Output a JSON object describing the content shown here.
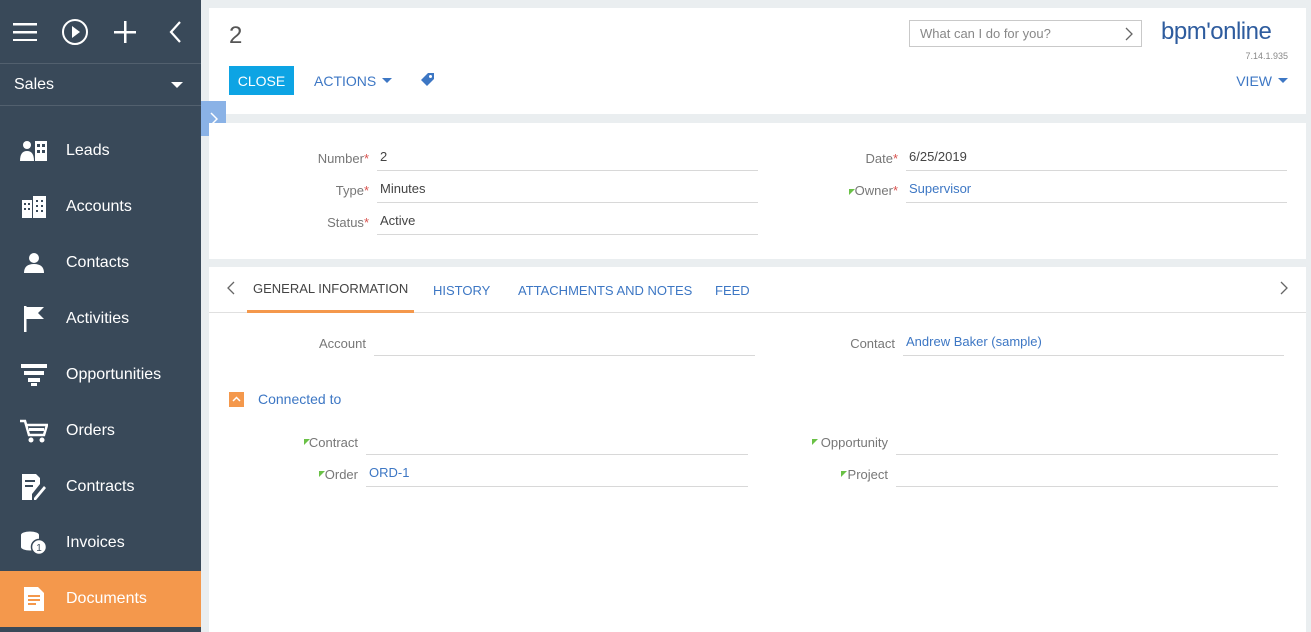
{
  "sidebar": {
    "workspace": "Sales",
    "items": [
      {
        "label": "Leads",
        "icon": "leads-icon"
      },
      {
        "label": "Accounts",
        "icon": "accounts-icon"
      },
      {
        "label": "Contacts",
        "icon": "contacts-icon"
      },
      {
        "label": "Activities",
        "icon": "activities-flag-icon"
      },
      {
        "label": "Opportunities",
        "icon": "opportunities-funnel-icon"
      },
      {
        "label": "Orders",
        "icon": "orders-cart-icon"
      },
      {
        "label": "Contracts",
        "icon": "contracts-icon"
      },
      {
        "label": "Invoices",
        "icon": "invoices-coins-icon"
      },
      {
        "label": "Documents",
        "icon": "documents-icon",
        "active": true
      }
    ]
  },
  "header": {
    "title": "2",
    "search_placeholder": "What can I do for you?",
    "logo": "bpm'online",
    "version": "7.14.1.935",
    "close_label": "CLOSE",
    "actions_label": "ACTIONS",
    "view_label": "VIEW"
  },
  "fields": {
    "number": {
      "label": "Number",
      "value": "2"
    },
    "type": {
      "label": "Type",
      "value": "Minutes"
    },
    "status": {
      "label": "Status",
      "value": "Active"
    },
    "date": {
      "label": "Date",
      "value": "6/25/2019"
    },
    "owner": {
      "label": "Owner",
      "value": "Supervisor"
    },
    "required_mark": "*"
  },
  "tabs": {
    "items": [
      "GENERAL INFORMATION",
      "HISTORY",
      "ATTACHMENTS AND NOTES",
      "FEED"
    ],
    "active_index": 0
  },
  "general": {
    "account": {
      "label": "Account",
      "value": ""
    },
    "contact": {
      "label": "Contact",
      "value": "Andrew Baker (sample)"
    },
    "group_title": "Connected to",
    "contract": {
      "label": "Contract",
      "value": ""
    },
    "opportunity": {
      "label": "Opportunity",
      "value": ""
    },
    "order": {
      "label": "Order",
      "value": "ORD-1"
    },
    "project": {
      "label": "Project",
      "value": ""
    }
  },
  "colors": {
    "sidebar_bg": "#394959",
    "active_item": "#f4984c",
    "primary_button": "#0da4e4",
    "link": "#3d77c4",
    "required": "#d9534f"
  }
}
